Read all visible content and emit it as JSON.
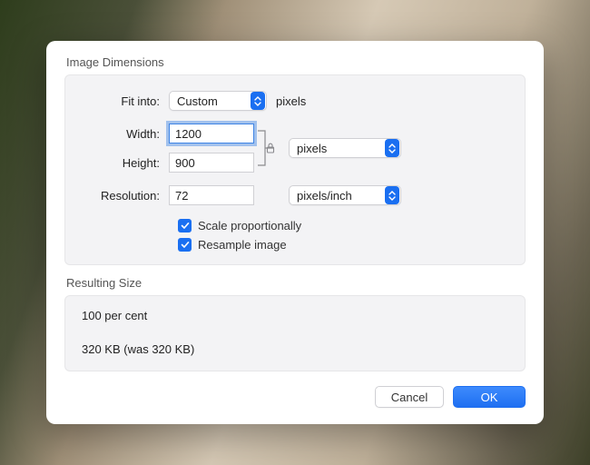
{
  "sections": {
    "imageDimensions": "Image Dimensions",
    "resultingSize": "Resulting Size"
  },
  "labels": {
    "fitInto": "Fit into:",
    "width": "Width:",
    "height": "Height:",
    "resolution": "Resolution:"
  },
  "values": {
    "fitInto": "Custom",
    "fitIntoUnits": "pixels",
    "width": "1200",
    "height": "900",
    "whUnits": "pixels",
    "resolution": "72",
    "resolutionUnits": "pixels/inch"
  },
  "checkboxes": {
    "scaleProportionally": {
      "label": "Scale proportionally",
      "checked": true
    },
    "resampleImage": {
      "label": "Resample image",
      "checked": true
    }
  },
  "resulting": {
    "percent": "100 per cent",
    "size": "320 KB (was 320 KB)"
  },
  "buttons": {
    "cancel": "Cancel",
    "ok": "OK"
  }
}
